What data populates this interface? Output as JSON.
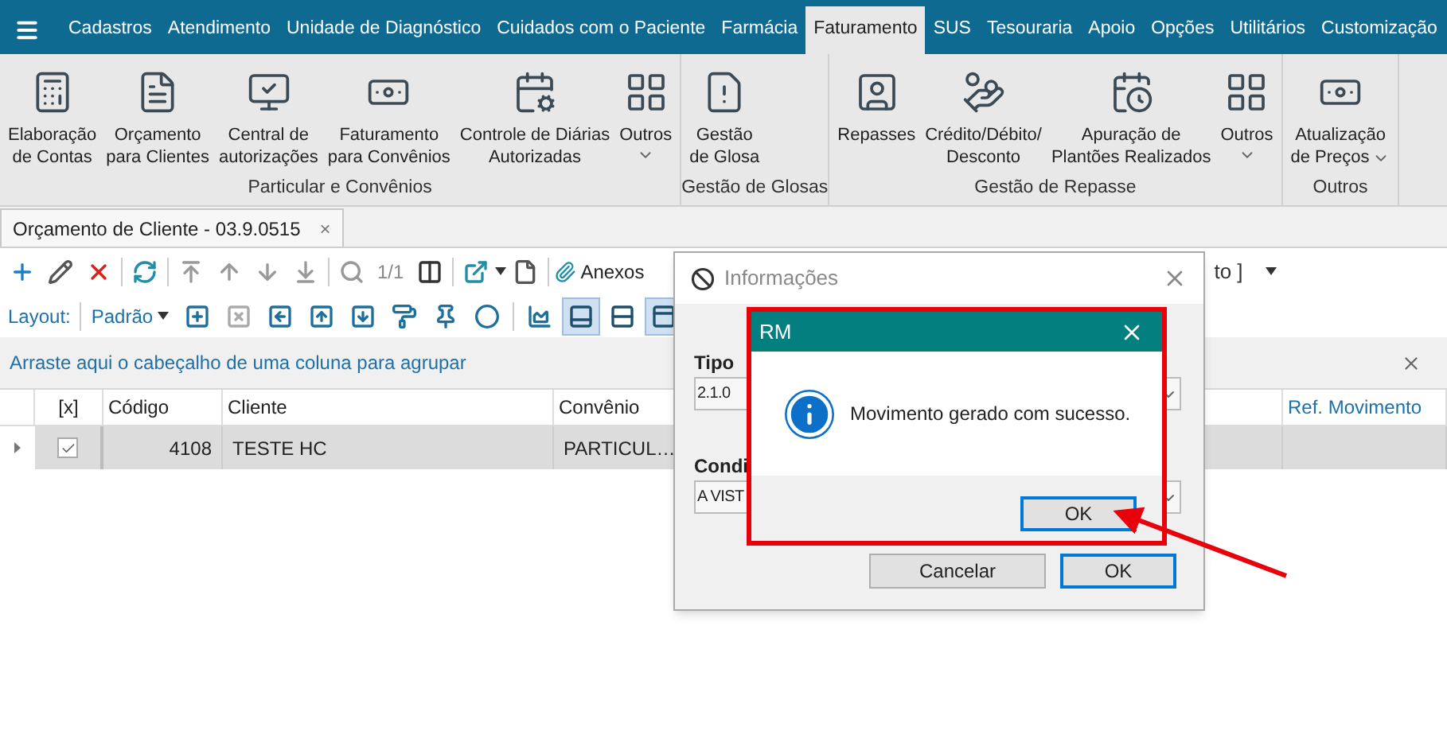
{
  "menu_tabs": [
    {
      "label": "Cadastros",
      "selected": false
    },
    {
      "label": "Atendimento",
      "selected": false
    },
    {
      "label": "Unidade de Diagnóstico",
      "selected": false
    },
    {
      "label": "Cuidados com o Paciente",
      "selected": false
    },
    {
      "label": "Farmácia",
      "selected": false
    },
    {
      "label": "Faturamento",
      "selected": true
    },
    {
      "label": "SUS",
      "selected": false
    },
    {
      "label": "Tesouraria",
      "selected": false
    },
    {
      "label": "Apoio",
      "selected": false
    },
    {
      "label": "Opções",
      "selected": false
    },
    {
      "label": "Utilitários",
      "selected": false
    },
    {
      "label": "Customização",
      "selected": false
    }
  ],
  "ribbon_groups": [
    {
      "title": "Particular e Convênios",
      "buttons": [
        {
          "lines": [
            "Elaboração",
            "de Contas"
          ],
          "dropdown": false
        },
        {
          "lines": [
            "Orçamento",
            "para Clientes"
          ],
          "dropdown": false
        },
        {
          "lines": [
            "Central de",
            "autorizações"
          ],
          "dropdown": false
        },
        {
          "lines": [
            "Faturamento",
            "para Convênios"
          ],
          "dropdown": false
        },
        {
          "lines": [
            "Controle de Diárias",
            "Autorizadas"
          ],
          "dropdown": false
        },
        {
          "lines": [
            "Outros"
          ],
          "dropdown": true
        }
      ]
    },
    {
      "title": "Gestão de Glosas",
      "buttons": [
        {
          "lines": [
            "Gestão",
            "de Glosa"
          ],
          "dropdown": false
        }
      ]
    },
    {
      "title": "Gestão de Repasse",
      "buttons": [
        {
          "lines": [
            "Repasses"
          ],
          "dropdown": false
        },
        {
          "lines": [
            "Crédito/Débito/",
            "Desconto"
          ],
          "dropdown": false
        },
        {
          "lines": [
            "Apuração de",
            "Plantões Realizados"
          ],
          "dropdown": false
        },
        {
          "lines": [
            "Outros"
          ],
          "dropdown": true
        }
      ]
    },
    {
      "title": "Outros",
      "buttons": [
        {
          "lines": [
            "Atualização",
            "de Preços"
          ],
          "dropdown": true
        }
      ]
    }
  ],
  "document_tab": {
    "title": "Orçamento de Cliente - 03.9.0515",
    "close": "×"
  },
  "toolbar": {
    "record_count": "1/1",
    "attachments": "Anexos",
    "cut_text": "to ]"
  },
  "layout_bar": {
    "label": "Layout:",
    "layout": "Padrão",
    "view_toggles": [
      {
        "selected": true
      },
      {
        "selected": false
      },
      {
        "selected": true
      }
    ]
  },
  "grid": {
    "group_hint": "Arraste aqui o cabeçalho de uma coluna para agrupar",
    "check_header": "[x]",
    "columns": [
      "Código",
      "Cliente",
      "Convênio",
      "Ref. Movimento"
    ],
    "rows": [
      {
        "selected": true,
        "checked": true,
        "cells": [
          "4108",
          "TESTE HC",
          "PARTICUL…",
          ""
        ]
      }
    ]
  },
  "info_dialog": {
    "title": "Informações",
    "fields": [
      {
        "label": "Tipo",
        "value": "2.1.0"
      },
      {
        "label": "Condi",
        "value": "A VIST"
      }
    ],
    "buttons": [
      {
        "label": "Cancelar",
        "default": false
      },
      {
        "label": "OK",
        "default": true
      }
    ]
  },
  "message_box": {
    "title": "RM",
    "message": "Movimento gerado com sucesso.",
    "button": "OK"
  }
}
